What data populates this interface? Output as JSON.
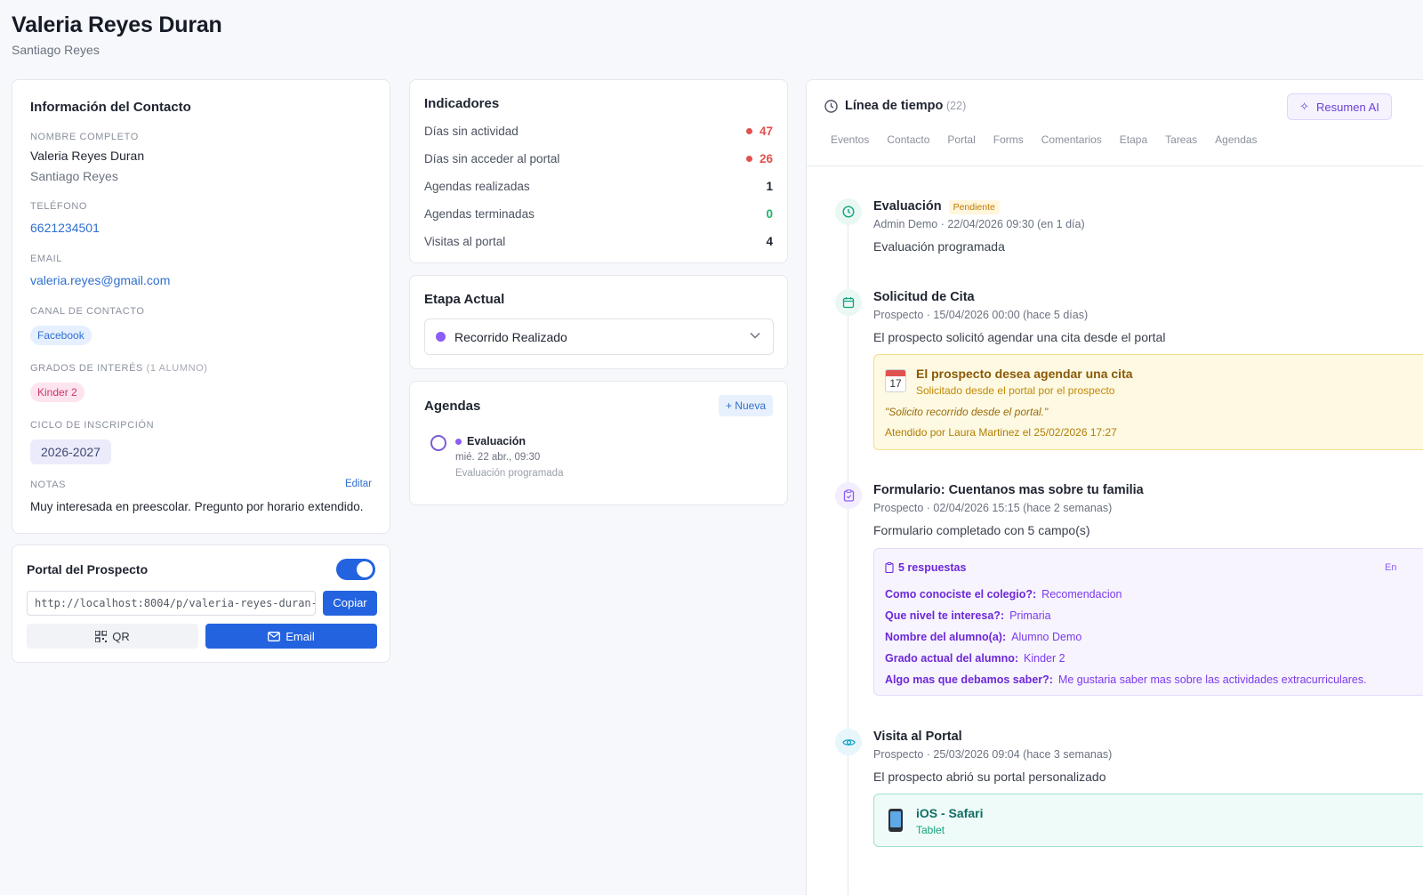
{
  "header": {
    "title": "Valeria Reyes Duran",
    "subtitle": "Santiago Reyes"
  },
  "contact": {
    "title": "Información del Contacto",
    "name_label": "NOMBRE COMPLETO",
    "name": "Valeria Reyes Duran",
    "parent": "Santiago Reyes",
    "phone_label": "TELÉFONO",
    "phone": "6621234501",
    "email_label": "EMAIL",
    "email": "valeria.reyes@gmail.com",
    "channel_label": "CANAL DE CONTACTO",
    "channel": "Facebook",
    "grades_label": "GRADOS DE INTERÉS",
    "grades_count": "(1 ALUMNO)",
    "grade": "Kinder 2",
    "cycle_label": "CICLO DE INSCRIPCIÓN",
    "cycle": "2026-2027",
    "notes_label": "NOTAS",
    "notes_edit": "Editar",
    "notes": "Muy interesada en preescolar. Pregunto por horario extendido."
  },
  "portal": {
    "title": "Portal del Prospecto",
    "url": "http://localhost:8004/p/valeria-reyes-duran-",
    "copy": "Copiar",
    "qr": "QR",
    "email": "Email"
  },
  "indicators": {
    "title": "Indicadores",
    "rows": [
      {
        "label": "Días sin actividad",
        "value": "47"
      },
      {
        "label": "Días sin acceder al portal",
        "value": "26"
      },
      {
        "label": "Agendas realizadas",
        "value": "1"
      },
      {
        "label": "Agendas terminadas",
        "value": "0"
      },
      {
        "label": "Visitas al portal",
        "value": "4"
      }
    ]
  },
  "stage": {
    "title": "Etapa Actual",
    "value": "Recorrido Realizado"
  },
  "agendas": {
    "title": "Agendas",
    "new": "+ Nueva",
    "item": {
      "title": "Evaluación",
      "date": "mié. 22 abr., 09:30",
      "desc": "Evaluación programada"
    }
  },
  "timeline": {
    "title": "Línea de tiempo",
    "count": "(22)",
    "ai_button": "Resumen AI",
    "tabs": [
      "Eventos",
      "Contacto",
      "Portal",
      "Forms",
      "Comentarios",
      "Etapa",
      "Tareas",
      "Agendas"
    ],
    "events": [
      {
        "title": "Evaluación",
        "badge": "Pendiente",
        "meta": "Admin Demo · 22/04/2026 09:30 (en 1 día)",
        "desc": "Evaluación programada"
      },
      {
        "title": "Solicitud de Cita",
        "meta": "Prospecto · 15/04/2026 00:00 (hace 5 días)",
        "desc": "El prospecto solicitó agendar una cita desde el portal",
        "box": {
          "title": "El prospecto desea agendar una cita",
          "sub": "Solicitado desde el portal por el prospecto",
          "quote": "\"Solicito recorrido desde el portal.\"",
          "attended": "Atendido por Laura Martinez el 25/02/2026 17:27",
          "cal_day": "17"
        }
      },
      {
        "title": "Formulario: Cuentanos mas sobre tu familia",
        "meta": "Prospecto · 02/04/2026 15:15 (hace 2 semanas)",
        "desc": "Formulario completado con 5 campo(s)",
        "box": {
          "title": "5 respuestas",
          "corner": "En",
          "rows": [
            {
              "q": "Como conociste el colegio?:",
              "a": "Recomendacion"
            },
            {
              "q": "Que nivel te interesa?:",
              "a": "Primaria"
            },
            {
              "q": "Nombre del alumno(a):",
              "a": "Alumno Demo"
            },
            {
              "q": "Grado actual del alumno:",
              "a": "Kinder 2"
            },
            {
              "q": "Algo mas que debamos saber?:",
              "a": "Me gustaria saber mas sobre las actividades extracurriculares."
            }
          ]
        }
      },
      {
        "title": "Visita al Portal",
        "meta": "Prospecto · 25/03/2026 09:04 (hace 3 semanas)",
        "desc": "El prospecto abrió su portal personalizado",
        "box": {
          "title": "iOS - Safari",
          "sub": "Tablet"
        }
      }
    ]
  }
}
